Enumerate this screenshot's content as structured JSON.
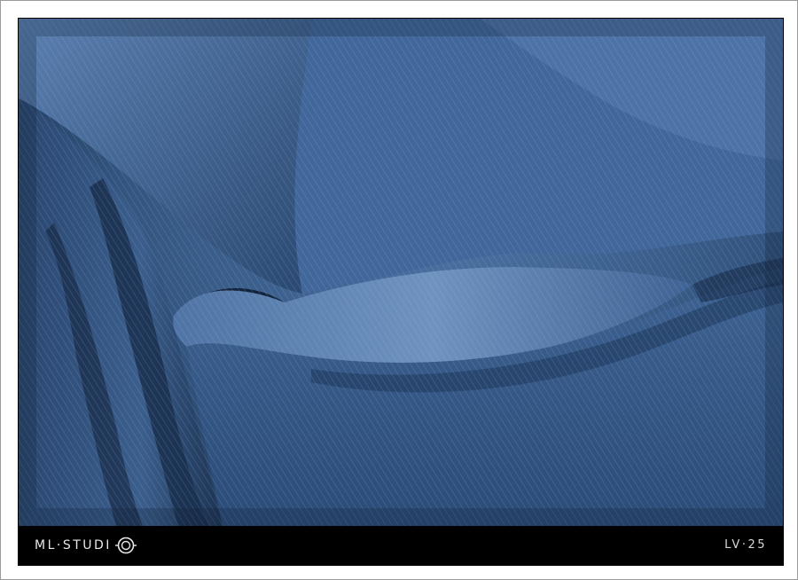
{
  "photo": {
    "subject": "denim-fabric",
    "colors": {
      "base": "#2f4d78",
      "highlight": "#6f93bf",
      "shadow": "#0f1e33"
    }
  },
  "caption": {
    "brand_left": "ML·STUDI",
    "brand_logo": "camera-lens-icon",
    "code": "LV·25"
  }
}
